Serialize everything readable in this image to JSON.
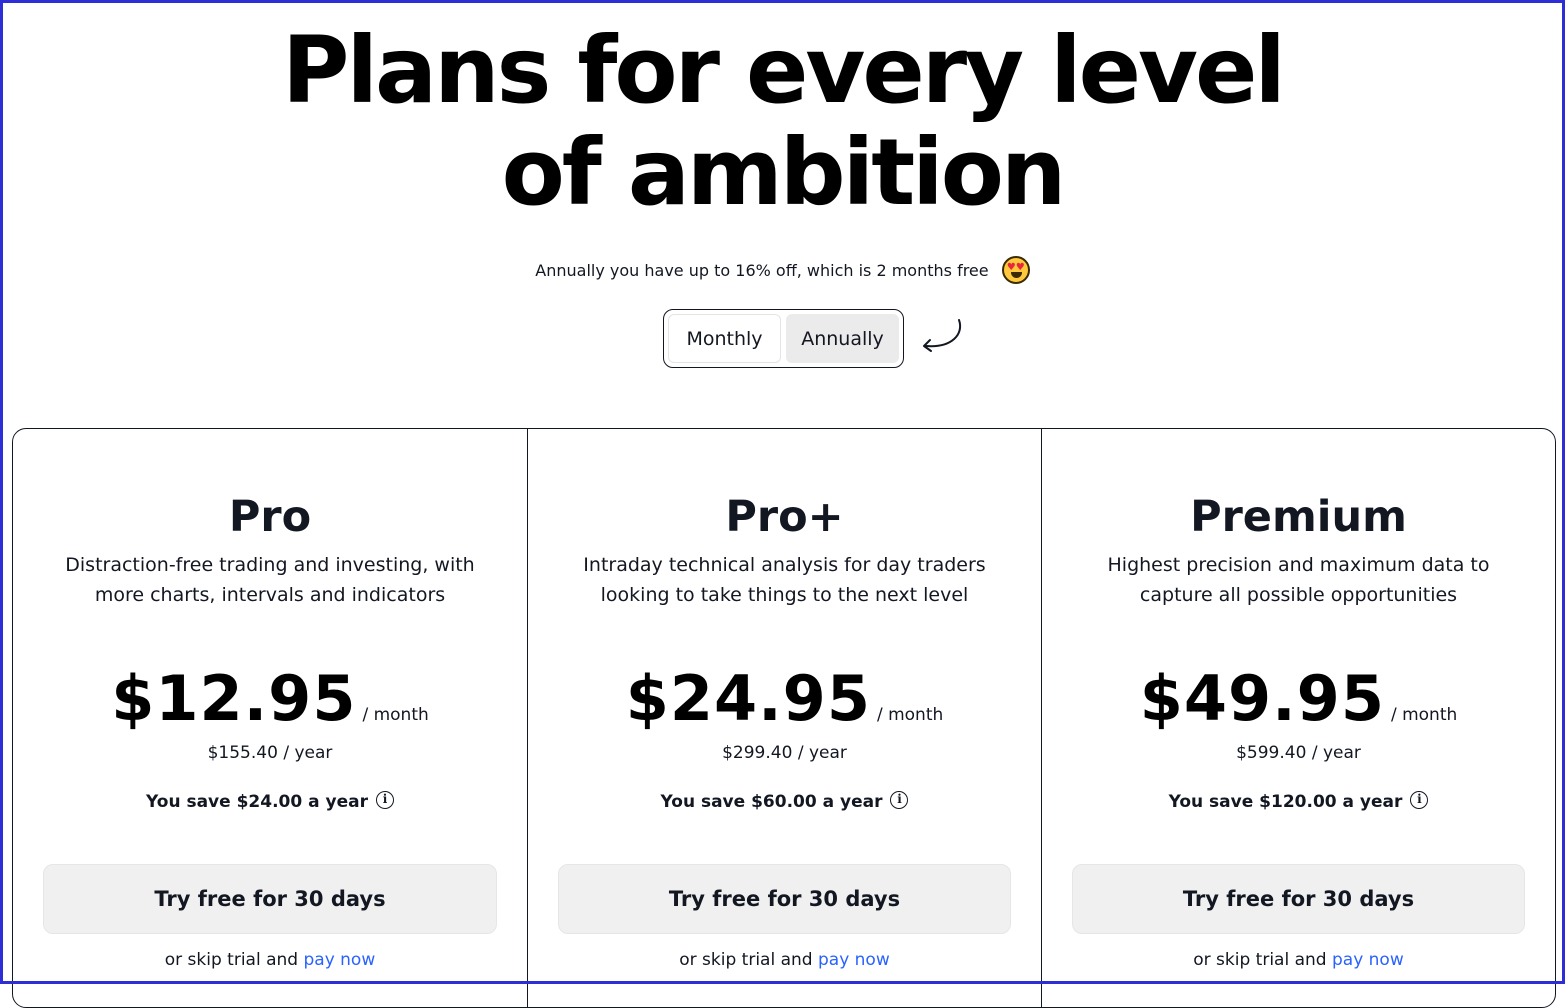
{
  "hero": {
    "title_line1": "Plans for every level",
    "title_line2": "of ambition"
  },
  "promo": {
    "text": "Annually you have up to 16% off, which is 2 months free",
    "emoji": "smiling-face-with-heart-eyes"
  },
  "billing_toggle": {
    "options": [
      "Monthly",
      "Annually"
    ],
    "selected": "Annually"
  },
  "plans": [
    {
      "name": "Pro",
      "description": "Distraction-free trading and investing, with more charts, intervals and indicators",
      "price": "$12.95",
      "period": "/ month",
      "yearly": "$155.40 / year",
      "savings": "You save $24.00 a year",
      "cta": "Try free for 30 days",
      "skip_prefix": "or skip trial and",
      "skip_link": "pay now"
    },
    {
      "name": "Pro+",
      "description": "Intraday technical analysis for day traders looking to take things to the next level",
      "price": "$24.95",
      "period": "/ month",
      "yearly": "$299.40 / year",
      "savings": "You save $60.00 a year",
      "cta": "Try free for 30 days",
      "skip_prefix": "or skip trial and",
      "skip_link": "pay now"
    },
    {
      "name": "Premium",
      "description": "Highest precision and maximum data to capture all possible opportunities",
      "price": "$49.95",
      "period": "/ month",
      "yearly": "$599.40 / year",
      "savings": "You save $120.00 a year",
      "cta": "Try free for 30 days",
      "skip_prefix": "or skip trial and",
      "skip_link": "pay now"
    }
  ],
  "colors": {
    "accent_link": "#2962ff",
    "frame_border": "#2e2ed6",
    "button_bg": "#f0f0f0",
    "toggle_active_bg": "#ebebeb"
  }
}
